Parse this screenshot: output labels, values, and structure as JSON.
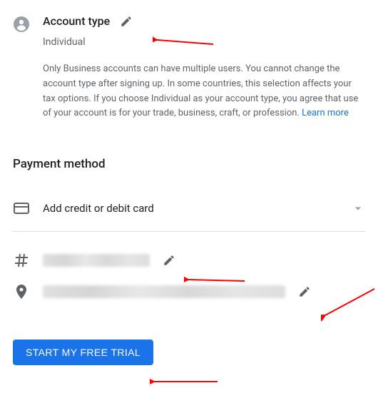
{
  "account": {
    "title": "Account type",
    "value": "Individual",
    "description": "Only Business accounts can have multiple users. You cannot change the account type after signing up. In some countries, this selection affects your tax options. If you choose Individual as your account type, you agree that use of your account is for your trade, business, craft, or profession. ",
    "learn_more": "Learn more"
  },
  "payment": {
    "heading": "Payment method",
    "add_card_label": "Add credit or debit card",
    "card_number": "[redacted]",
    "address": "[redacted]"
  },
  "cta": {
    "start_trial": "START MY FREE TRIAL"
  }
}
